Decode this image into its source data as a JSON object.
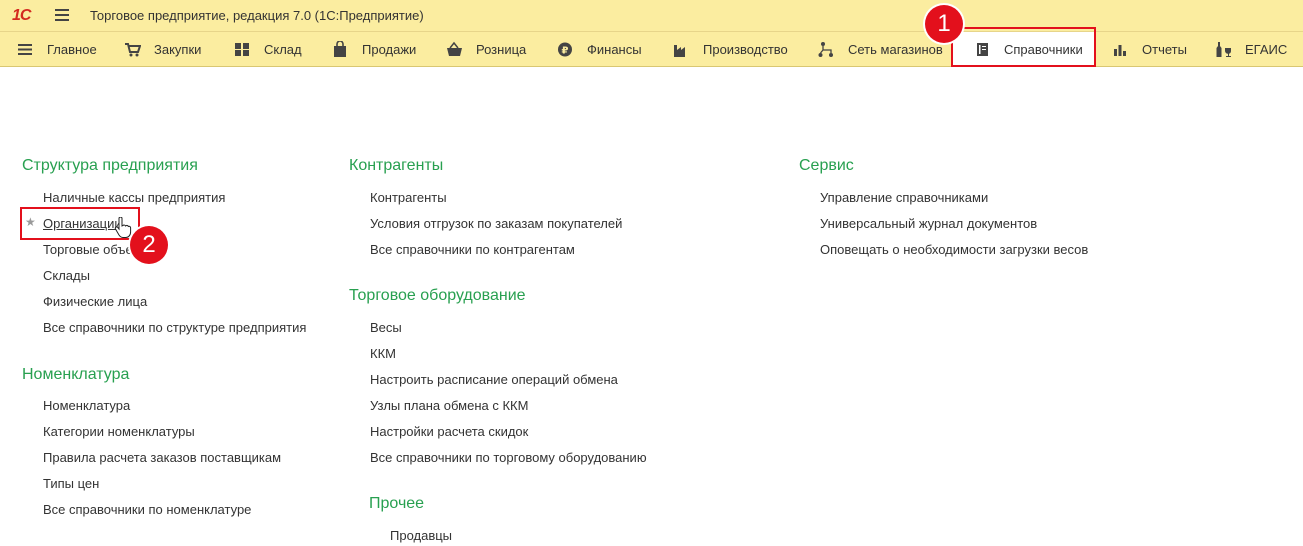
{
  "window": {
    "logo": "1С",
    "title": "Торговое предприятие, редакция 7.0  (1С:Предприятие)"
  },
  "menu": {
    "items": [
      {
        "label": "Главное",
        "icon": "list-icon"
      },
      {
        "label": "Закупки",
        "icon": "cart-icon"
      },
      {
        "label": "Склад",
        "icon": "grid-icon"
      },
      {
        "label": "Продажи",
        "icon": "bag-icon"
      },
      {
        "label": "Розница",
        "icon": "basket-icon"
      },
      {
        "label": "Финансы",
        "icon": "ruble-coin-icon"
      },
      {
        "label": "Производство",
        "icon": "factory-icon"
      },
      {
        "label": "Сеть магазинов",
        "icon": "network-icon"
      },
      {
        "label": "Справочники",
        "icon": "book-icon",
        "active": true
      },
      {
        "label": "Отчеты",
        "icon": "bar-chart-icon"
      },
      {
        "label": "ЕГАИС",
        "icon": "bottles-icon"
      }
    ]
  },
  "annotations": {
    "step1": "1",
    "step2": "2",
    "color": "#e3101c"
  },
  "sections": {
    "structure": {
      "title": "Структура предприятия",
      "links": [
        "Наличные кассы предприятия",
        "Организации",
        "Торговые объе",
        "Склады",
        "Физические лица",
        "Все справочники по структуре предприятия"
      ]
    },
    "nomenclature": {
      "title": "Номенклатура",
      "links": [
        "Номенклатура",
        "Категории номенклатуры",
        "Правила расчета заказов поставщикам",
        "Типы цен",
        "Все справочники по номенклатуре"
      ]
    },
    "counterparties": {
      "title": "Контрагенты",
      "links": [
        "Контрагенты",
        "Условия отгрузок по заказам покупателей",
        "Все справочники по контрагентам"
      ]
    },
    "equipment": {
      "title": "Торговое оборудование",
      "links": [
        "Весы",
        "ККМ",
        "Настроить расписание операций обмена",
        "Узлы плана обмена с ККМ",
        "Настройки расчета скидок",
        "Все справочники по торговому оборудованию"
      ]
    },
    "other": {
      "title": "Прочее",
      "links": [
        "Продавцы"
      ]
    },
    "service": {
      "title": "Сервис",
      "links": [
        "Управление справочниками",
        "Универсальный журнал документов",
        "Оповещать о необходимости загрузки весов"
      ]
    }
  },
  "colors": {
    "bar": "#fbeda0",
    "section_title": "#28a050",
    "logo": "#d32a1f"
  }
}
